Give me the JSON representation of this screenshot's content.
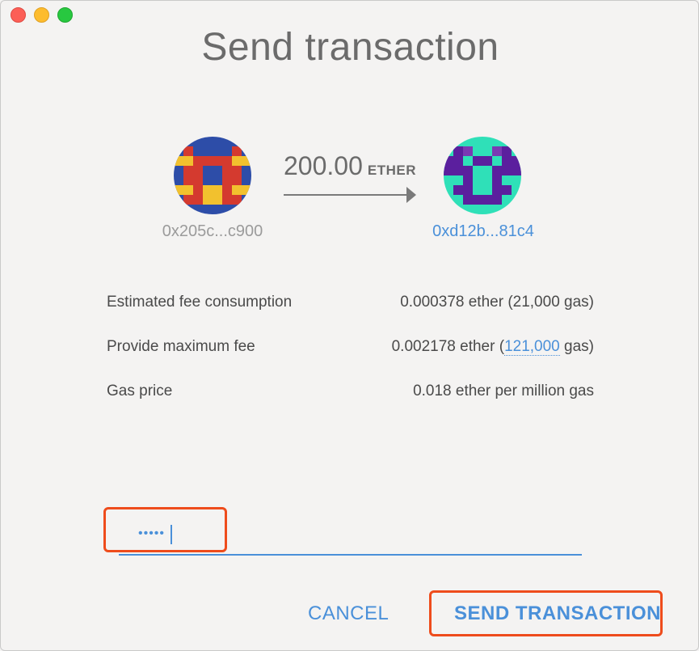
{
  "window": {
    "title": "Send transaction"
  },
  "from": {
    "address": "0x205c...c900",
    "icon": "identicon-blue-red-yellow"
  },
  "to": {
    "address": "0xd12b...81c4",
    "icon": "identicon-teal-purple"
  },
  "transfer": {
    "amount": "200.00",
    "unit": "ETHER"
  },
  "details": {
    "fee_label": "Estimated fee consumption",
    "fee_value": "0.000378 ether (21,000 gas)",
    "max_fee_label": "Provide maximum fee",
    "max_fee_prefix": "0.002178 ether (",
    "max_fee_gas": "121,000",
    "max_fee_suffix": " gas)",
    "gas_price_label": "Gas price",
    "gas_price_value": "0.018 ether per million gas"
  },
  "password": {
    "masked_value": "•••••"
  },
  "buttons": {
    "cancel": "CANCEL",
    "send": "SEND TRANSACTION"
  },
  "colors": {
    "accent": "#4a90d9",
    "highlight": "#ee4c1c"
  }
}
